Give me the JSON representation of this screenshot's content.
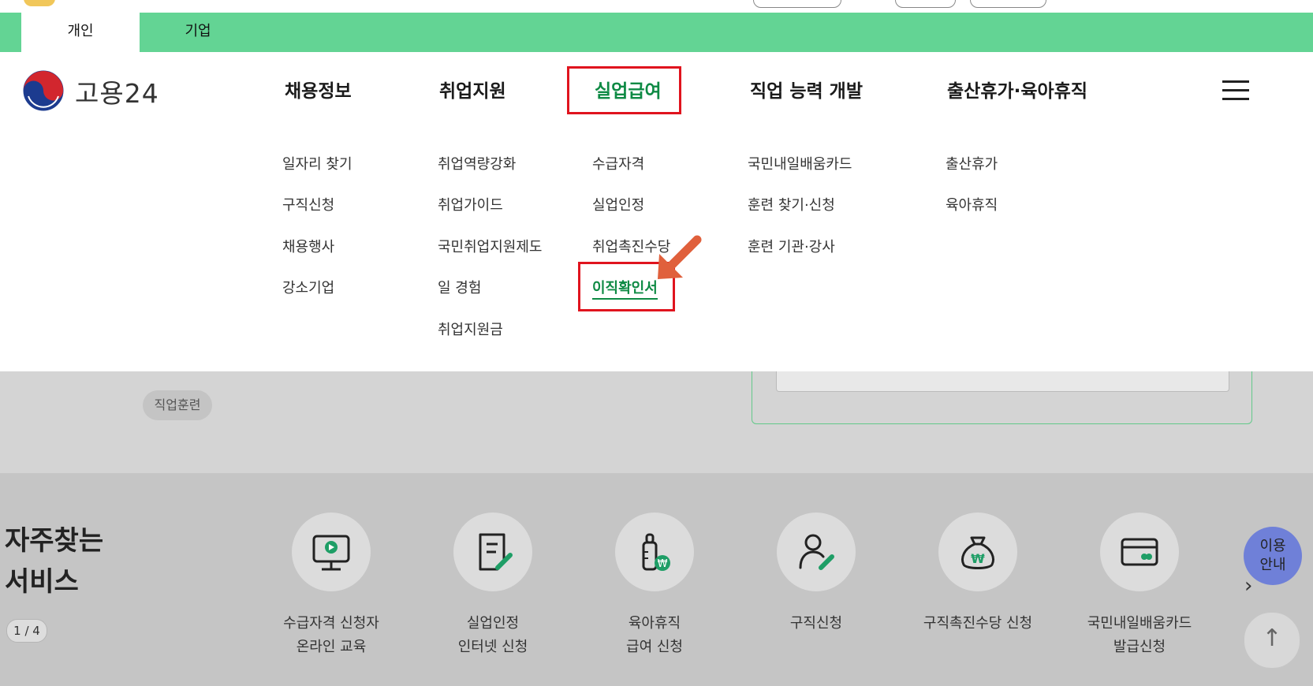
{
  "tabs": [
    "개인",
    "기업"
  ],
  "logo": {
    "text": "고용24"
  },
  "nav": {
    "items": [
      "채용정보",
      "취업지원",
      "실업급여",
      "직업 능력 개발",
      "출산휴가·육아휴직"
    ],
    "selected": "실업급여"
  },
  "submenu": {
    "col1": [
      "일자리 찾기",
      "구직신청",
      "채용행사",
      "강소기업"
    ],
    "col2": [
      "취업역량강화",
      "취업가이드",
      "국민취업지원제도",
      "일 경험",
      "취업지원금"
    ],
    "col3": [
      "수급자격",
      "실업인정",
      "취업촉진수당",
      "이직확인서"
    ],
    "col4": [
      "국민내일배움카드",
      "훈련 찾기·신청",
      "훈련 기관·강사"
    ],
    "col5": [
      "출산휴가",
      "육아휴직"
    ],
    "highlighted": "이직확인서"
  },
  "background": {
    "chip": "직업훈련"
  },
  "services": {
    "title_line1": "자주찾는",
    "title_line2": "서비스",
    "pager": "1 / 4",
    "items": [
      {
        "line1": "수급자격 신청자",
        "line2": "온라인 교육",
        "icon": "monitor-play-icon"
      },
      {
        "line1": "실업인정",
        "line2": "인터넷 신청",
        "icon": "document-pen-icon"
      },
      {
        "line1": "육아휴직",
        "line2": "급여 신청",
        "icon": "baby-bottle-won-icon"
      },
      {
        "line1": "구직신청",
        "line2": "",
        "icon": "person-pen-icon"
      },
      {
        "line1": "구직촉진수당 신청",
        "line2": "",
        "icon": "money-bag-won-icon"
      },
      {
        "line1": "국민내일배움카드",
        "line2": "발급신청",
        "icon": "card-icon"
      }
    ]
  },
  "guide_button": {
    "line1": "이용",
    "line2": "안내"
  },
  "colors": {
    "brand_green": "#0e8a44",
    "tab_bar": "#63d494",
    "highlight_red": "#e0141e",
    "arrow": "#e0603c",
    "guide_button": "#6f80d8"
  }
}
